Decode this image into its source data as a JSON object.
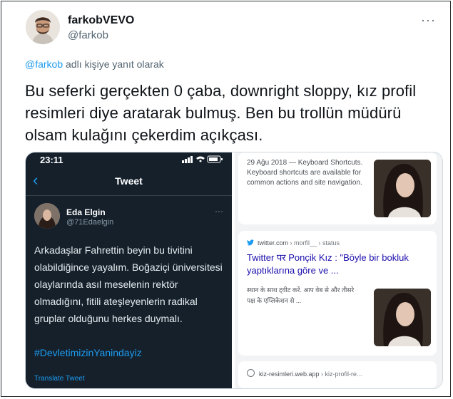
{
  "author": {
    "display_name": "farkobVEVO",
    "handle": "@farkob"
  },
  "reply": {
    "mention": "@farkob",
    "suffix": " adlı kişiye yanıt olarak"
  },
  "tweet": {
    "text": "Bu seferki gerçekten 0 çaba, downright sloppy, kız profil resimleri diye aratarak bulmuş. Ben bu trollün müdürü olsam kulağını çekerdim açıkçası."
  },
  "phone": {
    "time": "23:11",
    "header_title": "Tweet",
    "author_name": "Eda Elgin",
    "author_handle": "@71Edaelgin",
    "text": "Arkadaşlar Fahrettin beyin bu tivitini olabildiğince yayalım. Boğaziçi üniversitesi olaylarında asıl meselenin rektör olmadığını, fitili ateşleyenlerin radikal gruplar olduğunu herkes duymalı.",
    "hashtag": "#DevletimizinYanindayiz",
    "translate": "Translate Tweet"
  },
  "results": {
    "card1_text": "29 Ağu 2018 — Keyboard Shortcuts. Keyboard shortcuts are available for common actions and site navigation.",
    "card2_source": "twitter.com",
    "card2_path": " › morfil__ › status",
    "card2_title": "Twitter पर Ponçik Kız : \"Böyle bir bokluk yaptıklarına göre ve ...",
    "card2_snippet": "स्थान के साथ ट्वीट करें. आप वेब से और तीसरे पक्ष के एप्लिकेशन से ...",
    "card3_source": "kiz-resimleri.web.app",
    "card3_path": " › kiz-profil-re..."
  }
}
